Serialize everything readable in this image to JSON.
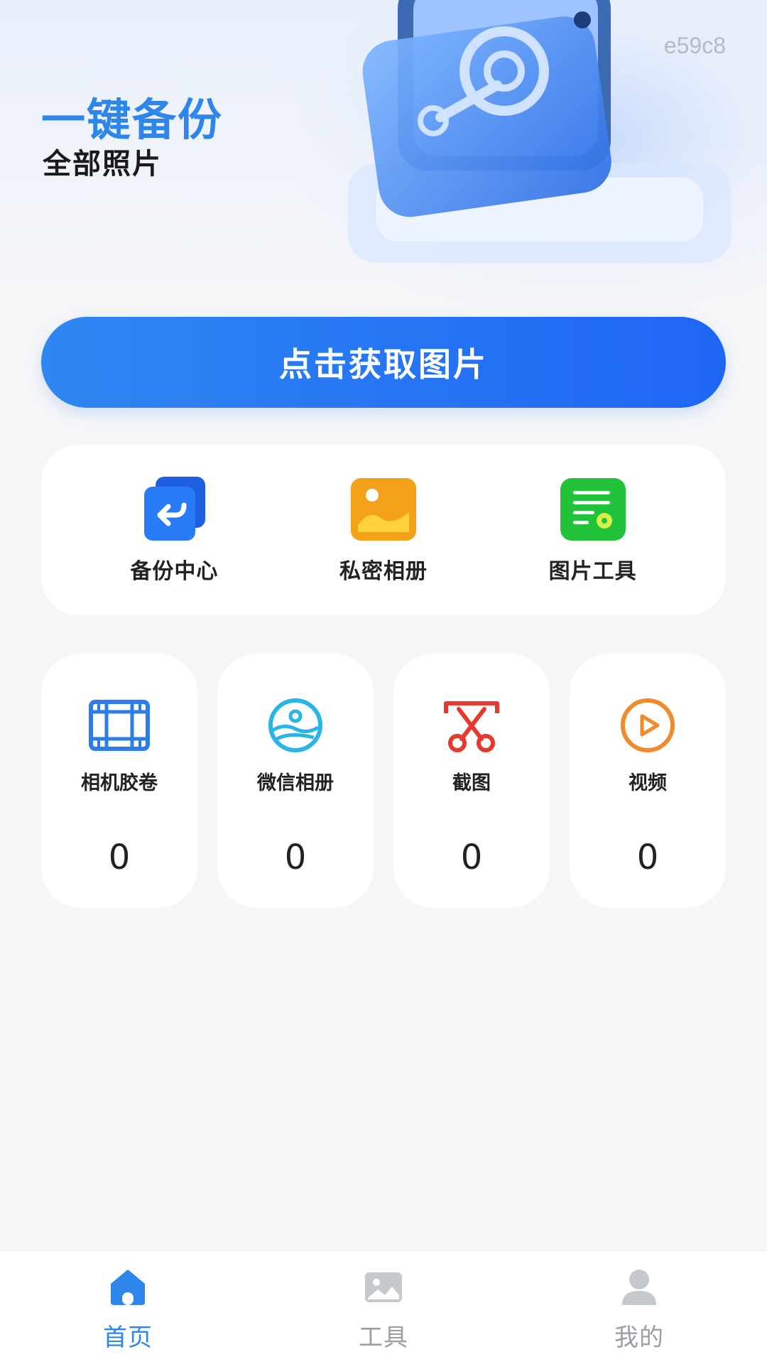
{
  "hero": {
    "title": "一键备份",
    "subtitle": "全部照片",
    "code": "e59c8"
  },
  "primary_button": {
    "label": "点击获取图片"
  },
  "features": [
    {
      "label": "备份中心",
      "icon": "backup-icon",
      "color": "#2a7cf6"
    },
    {
      "label": "私密相册",
      "icon": "private-album-icon",
      "color": "#f4a11a"
    },
    {
      "label": "图片工具",
      "icon": "image-tools-icon",
      "color": "#22c33a"
    }
  ],
  "stats": [
    {
      "label": "相机胶卷",
      "value": "0",
      "icon": "film-icon",
      "color": "#2c7de8"
    },
    {
      "label": "微信相册",
      "value": "0",
      "icon": "landscape-circle-icon",
      "color": "#2bb4e6"
    },
    {
      "label": "截图",
      "value": "0",
      "icon": "scissors-icon",
      "color": "#e6392f"
    },
    {
      "label": "视频",
      "value": "0",
      "icon": "play-icon",
      "color": "#f08a2a"
    }
  ],
  "tabs": [
    {
      "label": "首页",
      "icon": "home-icon",
      "active": true
    },
    {
      "label": "工具",
      "icon": "image-icon",
      "active": false
    },
    {
      "label": "我的",
      "icon": "user-icon",
      "active": false
    }
  ],
  "colors": {
    "accent": "#2f86ea",
    "button_start": "#2f87f2",
    "button_end": "#1e66f5",
    "background": "#f5f6f8",
    "tab_inactive": "#9b9ea3"
  }
}
